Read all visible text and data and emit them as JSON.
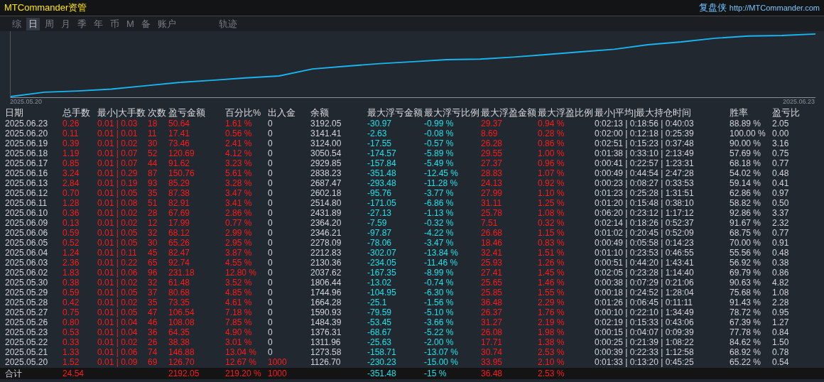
{
  "header": {
    "title": "MTCommander资管",
    "brand": "复盘侠",
    "url": "http://MTCommander.com"
  },
  "tabs": [
    {
      "label": "综",
      "selected": false
    },
    {
      "label": "日",
      "selected": true
    },
    {
      "label": "周",
      "selected": false
    },
    {
      "label": "月",
      "selected": false
    },
    {
      "label": "季",
      "selected": false
    },
    {
      "label": "年",
      "selected": false
    },
    {
      "label": "币",
      "selected": false
    },
    {
      "label": "M",
      "selected": false
    },
    {
      "label": "备",
      "selected": false
    },
    {
      "label": "账户",
      "selected": false
    },
    {
      "label": "轨迹",
      "selected": false
    }
  ],
  "chart": {
    "start_label": "2025.05.20",
    "end_label": "2025.06.23"
  },
  "table": {
    "columns": [
      "日期",
      "总手数",
      "最小|大手数",
      "次数",
      "盈亏金额",
      "百分比%",
      "出入金",
      "余额",
      "最大浮亏金额",
      "最大浮亏比例",
      "最大浮盈金额",
      "最大浮盈比例",
      "最小|平均|最大持仓时间",
      "胜率",
      "盈亏比"
    ],
    "rows": [
      {
        "cells": [
          "2025.06.23",
          "0.26",
          "0.01 | 0.03",
          "18",
          "50.64",
          "1.61 %",
          "0",
          "3192.05",
          "-30.97",
          "-0.99 %",
          "29.37",
          "0.94 %",
          "0:02:13 | 0:18:56 | 0:40:03",
          "88.89 %",
          "2.05"
        ],
        "deposit_active": false
      },
      {
        "cells": [
          "2025.06.20",
          "0.11",
          "0.01 | 0.01",
          "11",
          "17.41",
          "0.56 %",
          "0",
          "3141.41",
          "-2.63",
          "-0.08 %",
          "8.69",
          "0.28 %",
          "0:02:00 | 0:12:18 | 0:25:39",
          "100.00 %",
          "0.00"
        ],
        "deposit_active": false
      },
      {
        "cells": [
          "2025.06.19",
          "0.39",
          "0.01 | 0.02",
          "30",
          "73.46",
          "2.41 %",
          "0",
          "3124.00",
          "-17.55",
          "-0.57 %",
          "26.28",
          "0.86 %",
          "0:02:51 | 0:15:23 | 0:37:48",
          "90.00 %",
          "3.16"
        ],
        "deposit_active": false
      },
      {
        "cells": [
          "2025.06.18",
          "1.19",
          "0.01 | 0.07",
          "52",
          "120.69",
          "4.12 %",
          "0",
          "3050.54",
          "-174.57",
          "-5.89 %",
          "29.55",
          "1.00 %",
          "0:01:38 | 0:33:10 | 2:13:49",
          "57.69 %",
          "0.75"
        ],
        "deposit_active": false
      },
      {
        "cells": [
          "2025.06.17",
          "0.85",
          "0.01 | 0.07",
          "44",
          "91.62",
          "3.23 %",
          "0",
          "2929.85",
          "-157.84",
          "-5.49 %",
          "27.37",
          "0.96 %",
          "0:00:41 | 0:22:57 | 1:23:31",
          "68.18 %",
          "0.77"
        ],
        "deposit_active": false
      },
      {
        "cells": [
          "2025.06.16",
          "3.24",
          "0.01 | 0.29",
          "87",
          "150.76",
          "5.61 %",
          "0",
          "2838.23",
          "-351.48",
          "-12.45 %",
          "28.83",
          "1.07 %",
          "0:00:49 | 0:44:54 | 2:47:28",
          "54.02 %",
          "0.48"
        ],
        "deposit_active": false
      },
      {
        "cells": [
          "2025.06.13",
          "2.84",
          "0.01 | 0.19",
          "93",
          "85.29",
          "3.28 %",
          "0",
          "2687.47",
          "-293.48",
          "-11.28 %",
          "24.13",
          "0.92 %",
          "0:00:23 | 0:08:27 | 0:33:53",
          "59.14 %",
          "0.41"
        ],
        "deposit_active": false
      },
      {
        "cells": [
          "2025.06.12",
          "0.70",
          "0.01 | 0.05",
          "35",
          "87.38",
          "3.47 %",
          "0",
          "2602.18",
          "-95.76",
          "-3.77 %",
          "27.99",
          "1.10 %",
          "0:01:23 | 0:25:28 | 1:31:51",
          "62.86 %",
          "0.97"
        ],
        "deposit_active": false
      },
      {
        "cells": [
          "2025.06.11",
          "1.28",
          "0.01 | 0.08",
          "51",
          "82.91",
          "3.41 %",
          "0",
          "2514.80",
          "-171.05",
          "-6.86 %",
          "31.11",
          "1.25 %",
          "0:01:20 | 0:15:48 | 0:38:10",
          "58.82 %",
          "0.50"
        ],
        "deposit_active": false
      },
      {
        "cells": [
          "2025.06.10",
          "0.36",
          "0.01 | 0.02",
          "28",
          "67.69",
          "2.86 %",
          "0",
          "2431.89",
          "-27.13",
          "-1.13 %",
          "25.78",
          "1.08 %",
          "0:06:20 | 0:23:12 | 1:17:12",
          "92.86 %",
          "3.37"
        ],
        "deposit_active": false
      },
      {
        "cells": [
          "2025.06.09",
          "0.13",
          "0.01 | 0.02",
          "12",
          "17.99",
          "0.77 %",
          "0",
          "2364.20",
          "-7.59",
          "-0.32 %",
          "7.51",
          "0.32 %",
          "0:02:14 | 0:18:26 | 0:52:37",
          "91.67 %",
          "2.32"
        ],
        "deposit_active": false
      },
      {
        "cells": [
          "2025.06.06",
          "0.59",
          "0.01 | 0.05",
          "32",
          "68.12",
          "2.99 %",
          "0",
          "2346.21",
          "-97.87",
          "-4.22 %",
          "26.68",
          "1.15 %",
          "0:01:02 | 0:20:45 | 0:52:09",
          "68.75 %",
          "0.77"
        ],
        "deposit_active": false
      },
      {
        "cells": [
          "2025.06.05",
          "0.52",
          "0.01 | 0.05",
          "30",
          "65.26",
          "2.95 %",
          "0",
          "2278.09",
          "-78.06",
          "-3.47 %",
          "18.46",
          "0.83 %",
          "0:00:49 | 0:05:58 | 0:14:23",
          "70.00 %",
          "0.91"
        ],
        "deposit_active": false
      },
      {
        "cells": [
          "2025.06.04",
          "1.24",
          "0.01 | 0.11",
          "45",
          "82.47",
          "3.87 %",
          "0",
          "2212.83",
          "-302.07",
          "-13.84 %",
          "32.41",
          "1.51 %",
          "0:01:10 | 0:23:53 | 0:46:55",
          "55.56 %",
          "0.48"
        ],
        "deposit_active": false
      },
      {
        "cells": [
          "2025.06.03",
          "2.36",
          "0.01 | 0.22",
          "65",
          "92.74",
          "4.55 %",
          "0",
          "2130.36",
          "-234.05",
          "-11.46 %",
          "25.93",
          "1.26 %",
          "0:00:51 | 0:44:20 | 1:43:41",
          "56.92 %",
          "0.38"
        ],
        "deposit_active": false
      },
      {
        "cells": [
          "2025.06.02",
          "1.83",
          "0.01 | 0.06",
          "96",
          "231.18",
          "12.80 %",
          "0",
          "2037.62",
          "-167.35",
          "-8.99 %",
          "27.41",
          "1.45 %",
          "0:02:05 | 0:23:28 | 1:14:40",
          "69.79 %",
          "0.86"
        ],
        "deposit_active": false
      },
      {
        "cells": [
          "2025.05.30",
          "0.38",
          "0.01 | 0.02",
          "32",
          "61.48",
          "3.52 %",
          "0",
          "1806.44",
          "-13.02",
          "-0.74 %",
          "25.65",
          "1.46 %",
          "0:00:38 | 0:07:29 | 0:21:06",
          "90.63 %",
          "4.82"
        ],
        "deposit_active": false
      },
      {
        "cells": [
          "2025.05.29",
          "0.59",
          "0.01 | 0.05",
          "37",
          "80.68",
          "4.85 %",
          "0",
          "1744.96",
          "-104.95",
          "-6.30 %",
          "25.85",
          "1.55 %",
          "0:00:18 | 0:24:52 | 1:28:04",
          "75.68 %",
          "1.08"
        ],
        "deposit_active": false
      },
      {
        "cells": [
          "2025.05.28",
          "0.42",
          "0.01 | 0.02",
          "35",
          "73.35",
          "4.61 %",
          "0",
          "1664.28",
          "-25.1",
          "-1.56 %",
          "36.48",
          "2.29 %",
          "0:01:26 | 0:06:45 | 0:11:11",
          "91.43 %",
          "2.28"
        ],
        "deposit_active": false
      },
      {
        "cells": [
          "2025.05.27",
          "0.75",
          "0.01 | 0.05",
          "47",
          "106.54",
          "7.18 %",
          "0",
          "1590.93",
          "-79.59",
          "-5.10 %",
          "26.37",
          "1.76 %",
          "0:00:10 | 0:22:10 | 1:34:49",
          "78.72 %",
          "0.95"
        ],
        "deposit_active": false
      },
      {
        "cells": [
          "2025.05.26",
          "0.80",
          "0.01 | 0.04",
          "46",
          "108.08",
          "7.85 %",
          "0",
          "1484.39",
          "-53.45",
          "-3.66 %",
          "31.27",
          "2.19 %",
          "0:02:19 | 0:15:33 | 0:43:06",
          "67.39 %",
          "1.27"
        ],
        "deposit_active": false
      },
      {
        "cells": [
          "2025.05.23",
          "0.53",
          "0.01 | 0.04",
          "36",
          "64.35",
          "4.90 %",
          "0",
          "1376.31",
          "-68.67",
          "-5.22 %",
          "26.08",
          "1.98 %",
          "0:00:15 | 0:04:07 | 0:09:39",
          "77.78 %",
          "0.84"
        ],
        "deposit_active": false
      },
      {
        "cells": [
          "2025.05.22",
          "0.33",
          "0.01 | 0.02",
          "26",
          "38.38",
          "3.01 %",
          "0",
          "1311.96",
          "-25.63",
          "-2.00 %",
          "17.71",
          "1.38 %",
          "0:00:25 | 0:21:39 | 1:08:22",
          "84.62 %",
          "1.50"
        ],
        "deposit_active": false
      },
      {
        "cells": [
          "2025.05.21",
          "1.33",
          "0.01 | 0.06",
          "74",
          "146.88",
          "13.04 %",
          "0",
          "1273.58",
          "-158.71",
          "-13.07 %",
          "30.74",
          "2.53 %",
          "0:00:39 | 0:22:33 | 1:12:58",
          "68.92 %",
          "0.78"
        ],
        "deposit_active": false
      },
      {
        "cells": [
          "2025.05.20",
          "1.52",
          "0.01 | 0.09",
          "69",
          "126.70",
          "12.67 %",
          "1000",
          "1126.70",
          "-230.23",
          "-15.00 %",
          "33.95",
          "2.10 %",
          "0:01:33 | 0:13:20 | 0:45:25",
          "65.22 %",
          "0.54"
        ],
        "deposit_active": true
      }
    ],
    "total": {
      "label": "合计",
      "total_lots": "24.54",
      "pnl": "2192.05",
      "percent": "219.20 %",
      "deposit": "1000",
      "max_float_loss": "-351.48",
      "max_float_loss_pct": "-15 %",
      "max_float_profit": "36.48",
      "max_float_profit_pct": "2.53 %"
    }
  }
}
